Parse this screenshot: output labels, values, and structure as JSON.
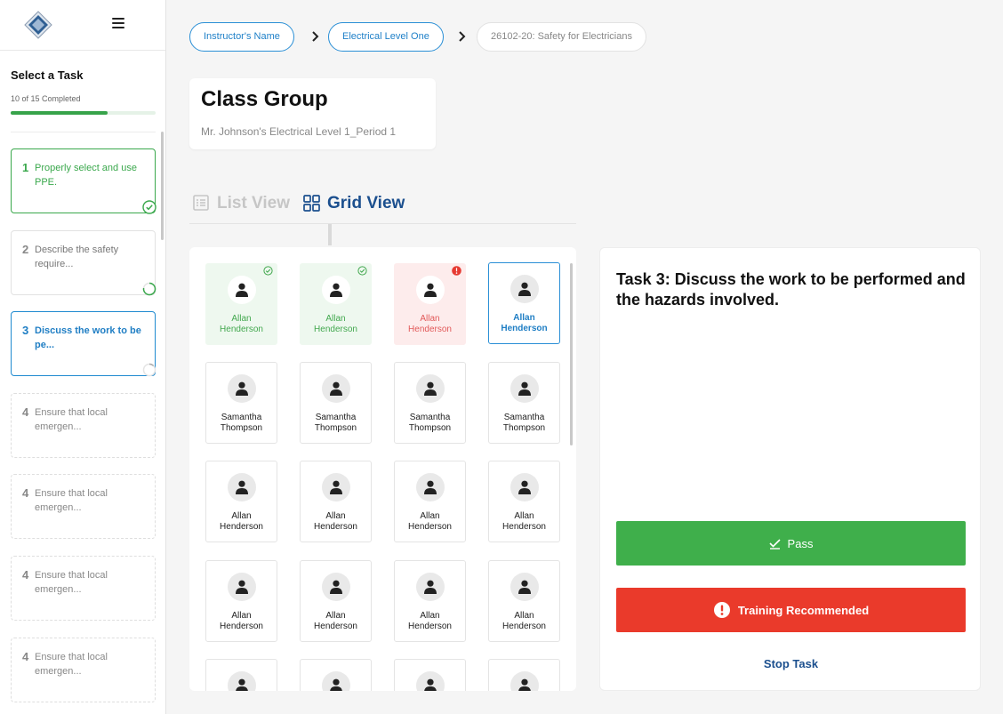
{
  "sidebar": {
    "heading": "Select a Task",
    "progress_text": "10 of 15 Completed",
    "progress_fraction": 0.667,
    "tasks": [
      {
        "num": "1",
        "label": "Properly select and use PPE.",
        "state": "done"
      },
      {
        "num": "2",
        "label": "Describe the safety require...",
        "state": "in-progress"
      },
      {
        "num": "3",
        "label": "Discuss the work to be pe...",
        "state": "active"
      },
      {
        "num": "4",
        "label": "Ensure that local emergen...",
        "state": "locked"
      },
      {
        "num": "4",
        "label": "Ensure that local emergen...",
        "state": "locked"
      },
      {
        "num": "4",
        "label": "Ensure that local emergen...",
        "state": "locked"
      },
      {
        "num": "4",
        "label": "Ensure that local emergen...",
        "state": "locked"
      }
    ]
  },
  "breadcrumb": {
    "items": [
      "Instructor's Name",
      "Electrical Level One",
      "26102-20: Safety for Electricians"
    ]
  },
  "class_group": {
    "title": "Class Group",
    "subtitle": "Mr. Johnson's Electrical Level 1_Period 1"
  },
  "views": {
    "list_label": "List View",
    "grid_label": "Grid View",
    "active": "grid"
  },
  "students": [
    {
      "first": "Allan",
      "last": "Henderson",
      "status": "pass"
    },
    {
      "first": "Allan",
      "last": "Henderson",
      "status": "pass"
    },
    {
      "first": "Allan",
      "last": "Henderson",
      "status": "fail"
    },
    {
      "first": "Allan",
      "last": "Henderson",
      "status": "selected"
    },
    {
      "first": "Samantha",
      "last": "Thompson",
      "status": "none"
    },
    {
      "first": "Samantha",
      "last": "Thompson",
      "status": "none"
    },
    {
      "first": "Samantha",
      "last": "Thompson",
      "status": "none"
    },
    {
      "first": "Samantha",
      "last": "Thompson",
      "status": "none"
    },
    {
      "first": "Allan",
      "last": "Henderson",
      "status": "none"
    },
    {
      "first": "Allan",
      "last": "Henderson",
      "status": "none"
    },
    {
      "first": "Allan",
      "last": "Henderson",
      "status": "none"
    },
    {
      "first": "Allan",
      "last": "Henderson",
      "status": "none"
    },
    {
      "first": "Allan",
      "last": "Henderson",
      "status": "none"
    },
    {
      "first": "Allan",
      "last": "Henderson",
      "status": "none"
    },
    {
      "first": "Allan",
      "last": "Henderson",
      "status": "none"
    },
    {
      "first": "Allan",
      "last": "Henderson",
      "status": "none"
    }
  ],
  "detail": {
    "title": "Task 3: Discuss the work to be performed and the hazards involved.",
    "pass_label": "Pass",
    "training_label": "Training Recommended",
    "stop_label": "Stop Task"
  },
  "colors": {
    "pass_green": "#3faf4b",
    "fail_red": "#ea3a2b",
    "link_blue": "#1f80c8",
    "navy": "#1b4f8e"
  }
}
